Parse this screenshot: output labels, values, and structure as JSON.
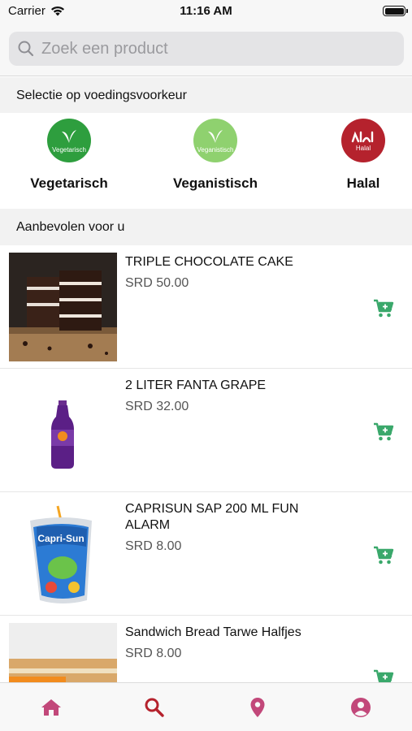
{
  "status_bar": {
    "carrier": "Carrier",
    "time": "11:16 AM"
  },
  "search": {
    "placeholder": "Zoek een product",
    "icon": "search-icon"
  },
  "preferences": {
    "title": "Selectie op voedingsvoorkeur",
    "items": [
      {
        "badge_text": "Vegetarisch",
        "label": "Vegetarisch",
        "color": "#2e9e3e"
      },
      {
        "badge_text": "Veganistisch",
        "label": "Veganistisch",
        "color": "#8fd16f"
      },
      {
        "badge_text": "Halal",
        "label": "Halal",
        "color": "#b5222d"
      }
    ]
  },
  "recommended": {
    "title": "Aanbevolen voor u",
    "products": [
      {
        "name": "TRIPLE CHOCOLATE CAKE",
        "price": "SRD 50.00",
        "image": "chocolate-cake-image"
      },
      {
        "name": "2 LITER FANTA GRAPE",
        "price": "SRD 32.00",
        "image": "fanta-grape-bottle-image"
      },
      {
        "name": "CAPRISUN SAP 200 ML FUN ALARM",
        "price": "SRD 8.00",
        "image": "caprisun-pouch-image",
        "badge_text": "Capri-Sun"
      },
      {
        "name": "Sandwich Bread Tarwe Halfjes",
        "price": "SRD 8.00",
        "image": "sandwich-bread-image"
      }
    ]
  },
  "colors": {
    "accent_green": "#3aa86b",
    "tab_pink": "#c2487a",
    "tab_active": "#b5222d"
  },
  "tab_bar": {
    "tabs": [
      "home-icon",
      "search-icon",
      "location-pin-icon",
      "profile-icon"
    ],
    "active": "search-icon"
  }
}
